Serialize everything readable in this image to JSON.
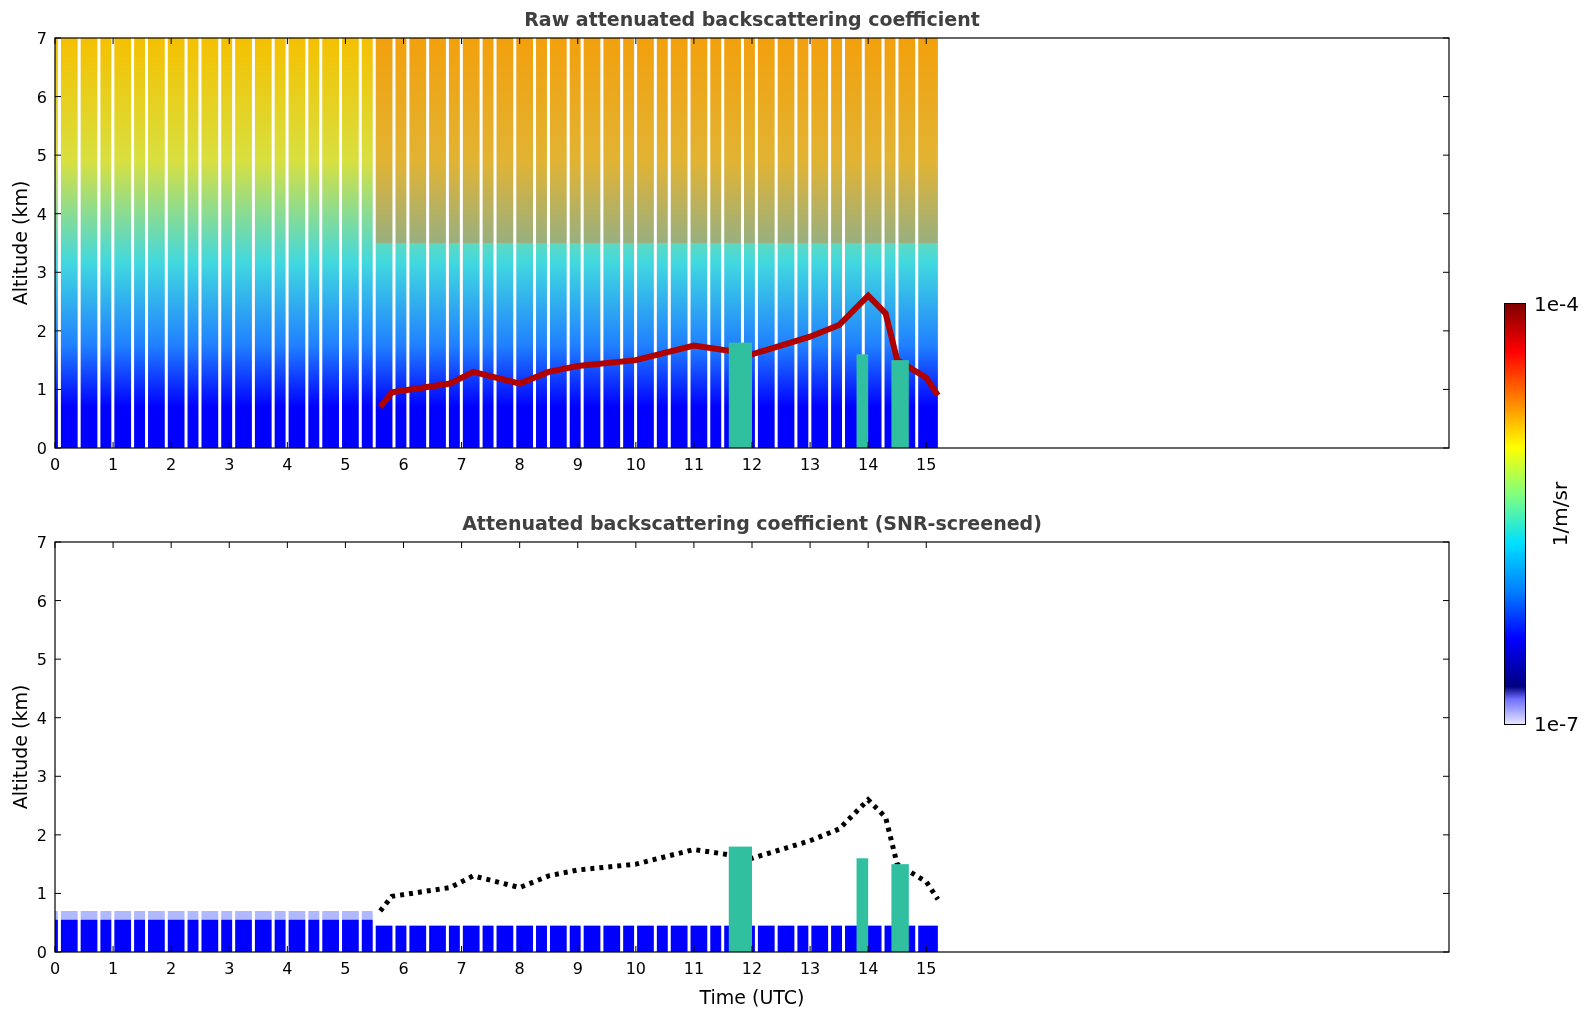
{
  "panels": [
    {
      "kind": "raw",
      "title": "Raw attenuated backscattering coefficient",
      "ylabel": "Altitude (km)",
      "yticks": [
        "7",
        "6",
        "5",
        "4",
        "3",
        "2",
        "1",
        "0"
      ],
      "xticks": [
        "0",
        "1",
        "2",
        "3",
        "4",
        "5",
        "6",
        "7",
        "8",
        "9",
        "10",
        "11",
        "12",
        "13",
        "14",
        "15"
      ]
    },
    {
      "kind": "screened",
      "title": "Attenuated backscattering coefficient (SNR-screened)",
      "ylabel": "Altitude (km)",
      "xlabel": "Time (UTC)",
      "yticks": [
        "7",
        "6",
        "5",
        "4",
        "3",
        "2",
        "1",
        "0"
      ],
      "xticks": [
        "0",
        "1",
        "2",
        "3",
        "4",
        "5",
        "6",
        "7",
        "8",
        "9",
        "10",
        "11",
        "12",
        "13",
        "14",
        "15"
      ]
    }
  ],
  "colorbar": {
    "label": "1/m/sr",
    "max_label": "1e-4",
    "min_label": "1e-7"
  }
}
